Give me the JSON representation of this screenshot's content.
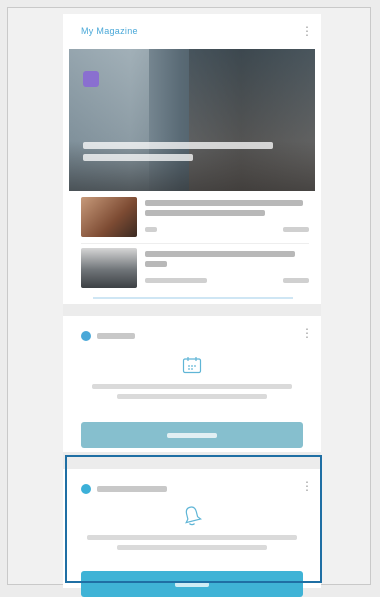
{
  "news": {
    "header_title": "My Magazine",
    "menu_icon": "more-vert-icon",
    "hero": {
      "badge_color": "#8a6fd0"
    },
    "items": [
      {
        "thumb": "news-thumb-1"
      },
      {
        "thumb": "news-thumb-2"
      }
    ]
  },
  "schedule": {
    "icon": "calendar-icon",
    "accent": "#4aa8d8",
    "menu_icon": "more-vert-icon"
  },
  "reminder": {
    "icon": "bell-icon",
    "accent": "#3cb0d8",
    "menu_icon": "more-vert-icon"
  },
  "colors": {
    "background": "#ececec",
    "card": "#ffffff",
    "highlight_border": "#1f6fa4"
  }
}
